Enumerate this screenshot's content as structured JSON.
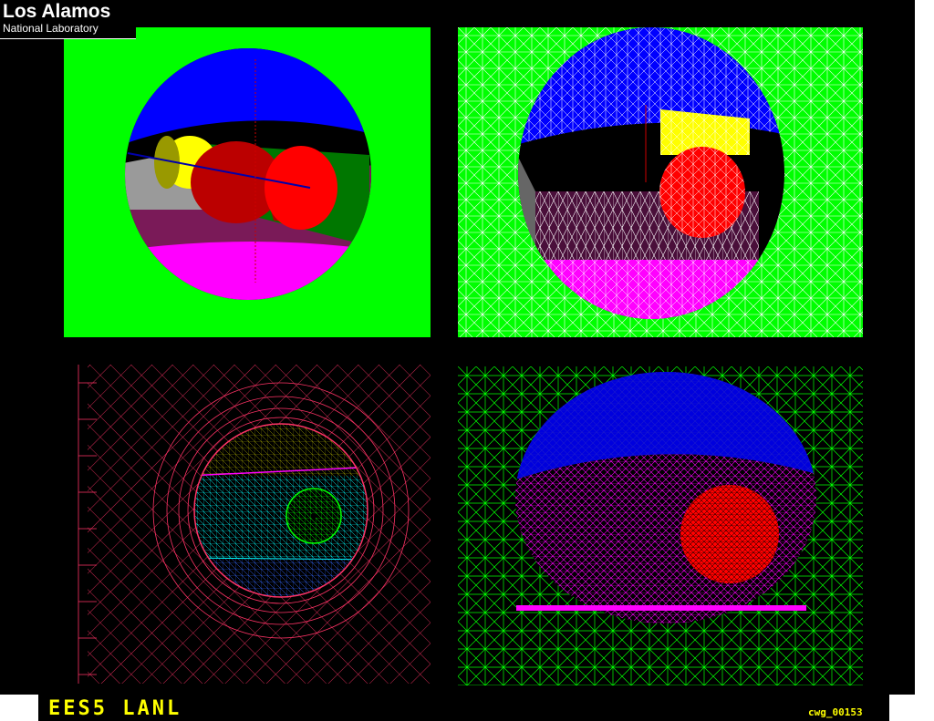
{
  "logo": {
    "title": "Los Alamos",
    "subtitle": "National Laboratory"
  },
  "footer": {
    "left_label": "EES5 LANL",
    "image_id": "cwg_00153"
  },
  "panels": [
    {
      "name": "solid-geometry-view",
      "background": "#00ff00"
    },
    {
      "name": "wireframe-mesh-view",
      "background": "#00ff00"
    },
    {
      "name": "quad-mesh-slice-view",
      "background": "#000000"
    },
    {
      "name": "tri-mesh-slice-view",
      "background": "#000000"
    }
  ],
  "colors": {
    "green": "#00ff00",
    "blue": "#0000ff",
    "yellow": "#ffff00",
    "red": "#ff0000",
    "magenta": "#ff00ff",
    "cyan": "#00ffff",
    "crimson": "#ff3366",
    "white": "#ffffff"
  }
}
